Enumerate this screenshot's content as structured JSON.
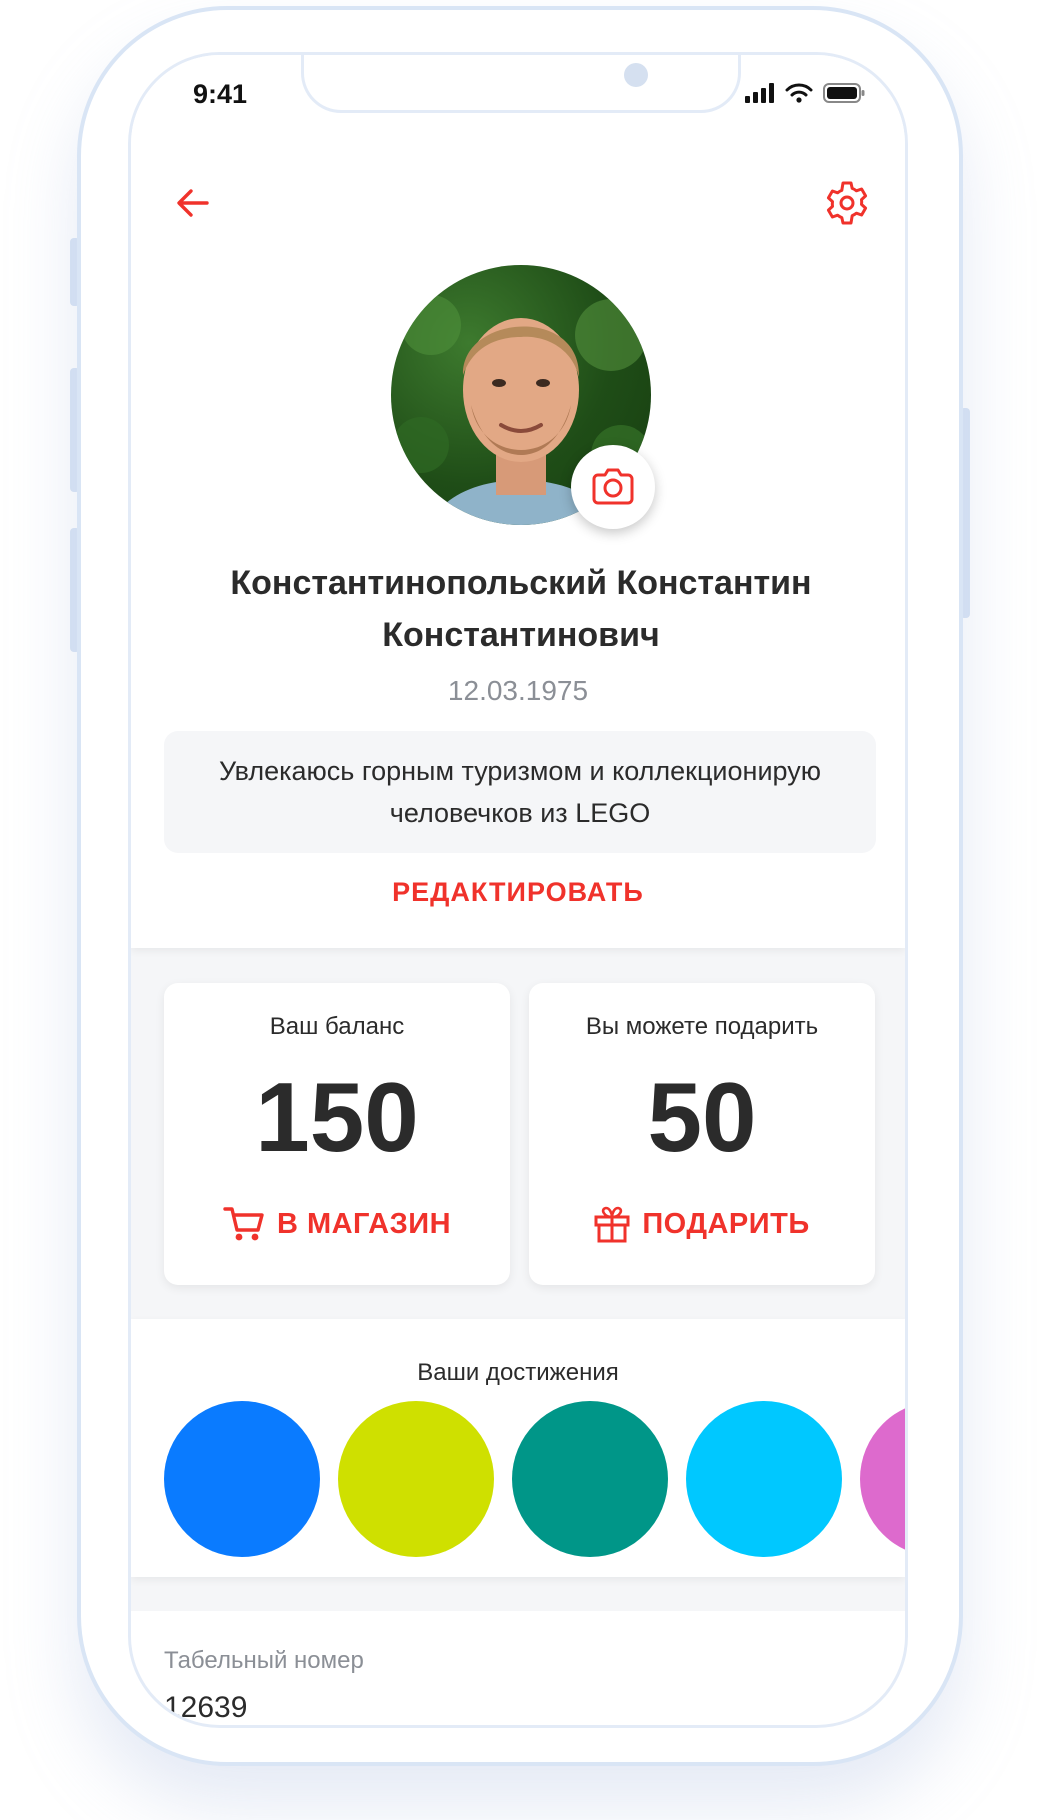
{
  "status_bar": {
    "time": "9:41"
  },
  "header": {
    "back_icon": "arrow-left-icon",
    "settings_icon": "gear-icon"
  },
  "profile": {
    "name": "Константинопольский Константин Константинович",
    "birth_date": "12.03.1975",
    "about": "Увлекаюсь горным туризмом и коллекционирую человечков из LEGO",
    "edit_label": "РЕДАКТИРОВАТЬ"
  },
  "balance": {
    "caption": "Ваш баланс",
    "value": "150",
    "action_label": "В МАГАЗИН"
  },
  "gift": {
    "caption": "Вы можете подарить",
    "value": "50",
    "action_label": "ПОДАРИТЬ"
  },
  "achievements": {
    "title": "Ваши достижения",
    "badge_colors": [
      "#0a7bff",
      "#cfe000",
      "#009688",
      "#00c8ff",
      "#dd6acd"
    ]
  },
  "employee": {
    "label": "Табельный номер",
    "value": "12639"
  },
  "colors": {
    "accent": "#f0322b",
    "text": "#2b2b2b",
    "muted": "#8b8f96"
  }
}
